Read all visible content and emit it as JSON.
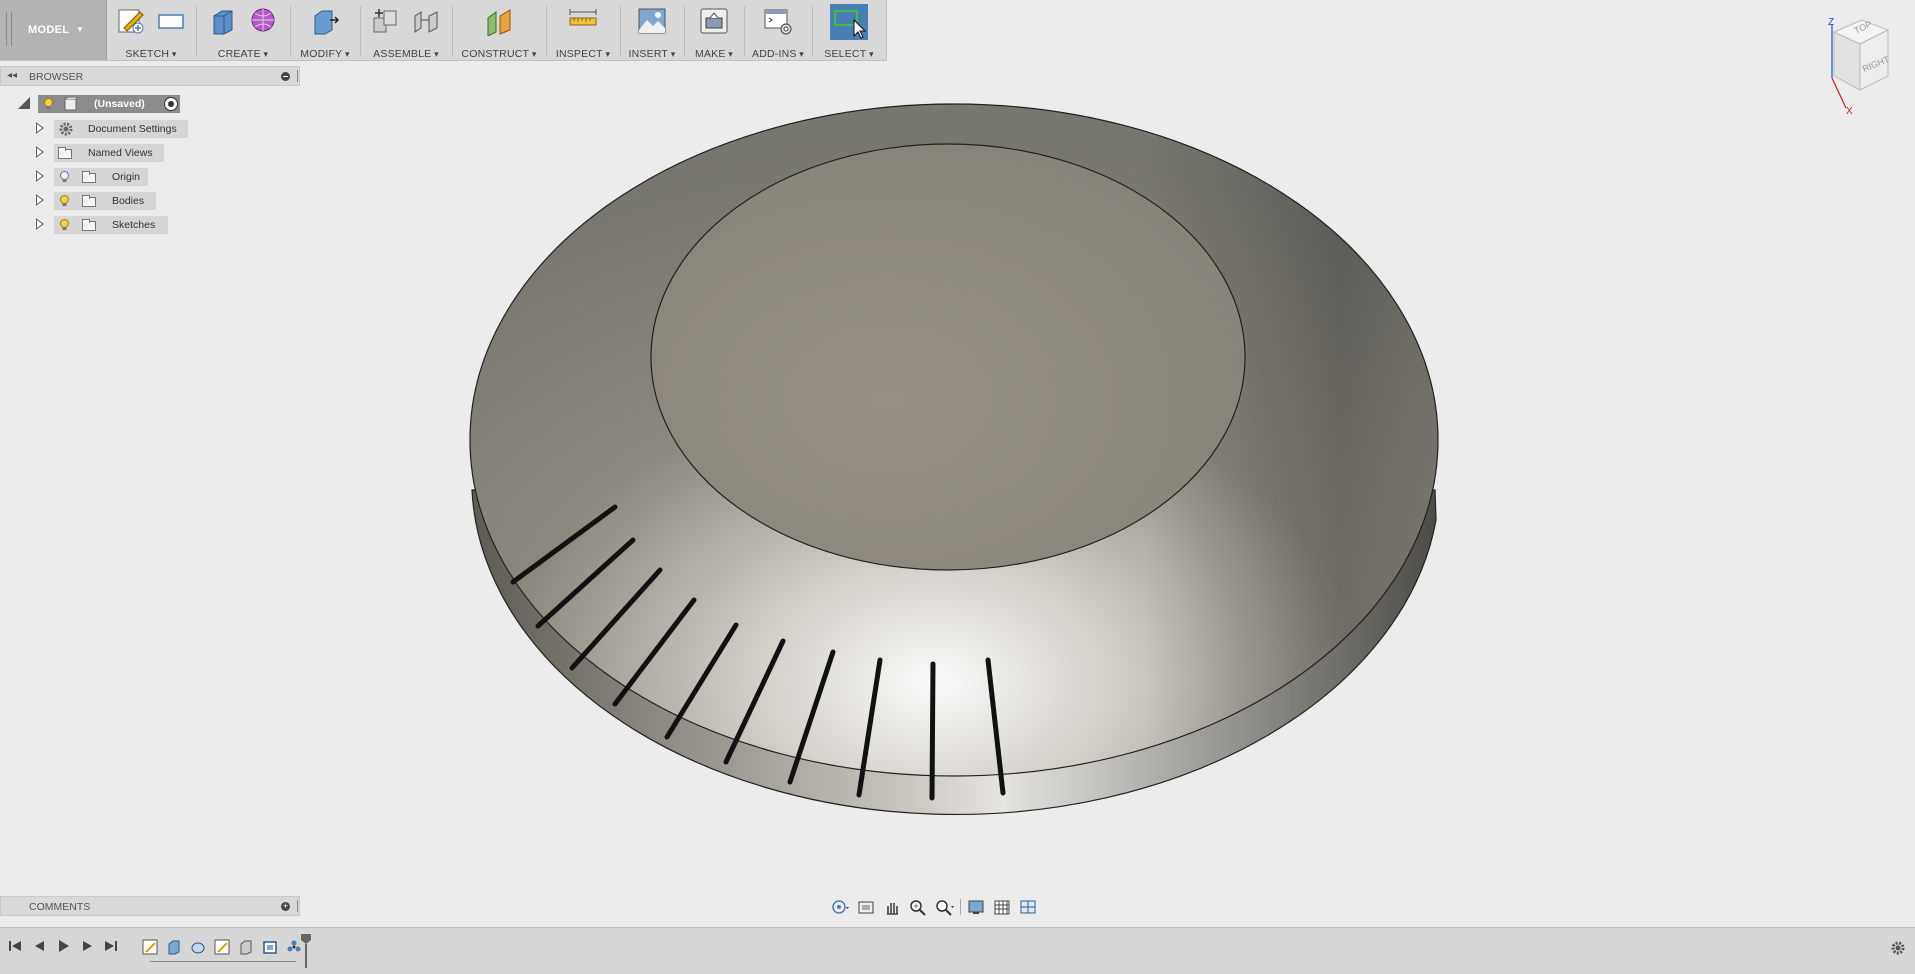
{
  "toolbar": {
    "workspace": "MODEL",
    "groups": {
      "sketch": "SKETCH",
      "create": "CREATE",
      "modify": "MODIFY",
      "assemble": "ASSEMBLE",
      "construct": "CONSTRUCT",
      "inspect": "INSPECT",
      "insert": "INSERT",
      "make": "MAKE",
      "addins": "ADD-INS",
      "select": "SELECT"
    }
  },
  "browser": {
    "title": "BROWSER",
    "root": "(Unsaved)",
    "items": [
      {
        "label": "Document Settings",
        "icon": "gear-icon"
      },
      {
        "label": "Named Views",
        "icon": "folder-icon"
      },
      {
        "label": "Origin",
        "icon": "folder-icon"
      },
      {
        "label": "Bodies",
        "icon": "folder-icon"
      },
      {
        "label": "Sketches",
        "icon": "folder-icon"
      }
    ]
  },
  "comments": {
    "title": "COMMENTS"
  },
  "viewcube": {
    "top_label": "TOP",
    "right_label": "RIGHT",
    "axis_z": "Z",
    "axis_x": "X"
  },
  "colors": {
    "toolbar_bg": "#d8d8d8",
    "workspace_bg": "#b3b3b3",
    "viewport_bg": "#ececec",
    "select_active": "#4a7fb5",
    "axis_z": "#2255cc",
    "axis_x": "#cc2222",
    "model_surface": "#8c887f"
  }
}
